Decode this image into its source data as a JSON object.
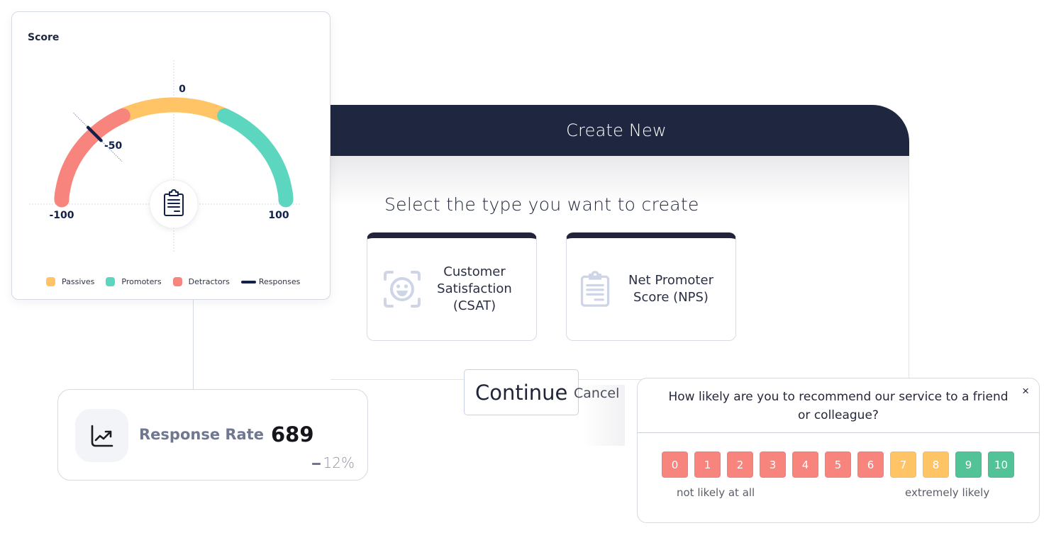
{
  "dialog": {
    "title": "Create New",
    "subtitle": "Select the type you want to create",
    "options": [
      {
        "label": "Customer Satisfaction (CSAT)",
        "icon": "smile-face-scan-icon"
      },
      {
        "label": "Net Promoter Score (NPS)",
        "icon": "clipboard-icon"
      }
    ],
    "continue_label": "Continue",
    "cancel_label": "Cancel"
  },
  "score_card": {
    "title": "Score",
    "gauge": {
      "min": -100,
      "max": 100,
      "labels": [
        "-100",
        "-50",
        "0",
        "100"
      ],
      "segments": [
        {
          "name": "Detractors",
          "from": -100,
          "to": -30,
          "color": "#f8847e"
        },
        {
          "name": "Passives",
          "from": -30,
          "to": 30,
          "color": "#fec466"
        },
        {
          "name": "Promoters",
          "from": 30,
          "to": 100,
          "color": "#5dd6c0"
        }
      ],
      "marker_value": -50,
      "marker_color": "#12204a",
      "center_icon": "clipboard-icon"
    },
    "legend": [
      {
        "label": "Passives",
        "color": "#fec466",
        "type": "swatch"
      },
      {
        "label": "Promoters",
        "color": "#5dd6c0",
        "type": "swatch"
      },
      {
        "label": "Detractors",
        "color": "#f8847e",
        "type": "swatch"
      },
      {
        "label": "Responses",
        "color": "#12204a",
        "type": "line"
      }
    ]
  },
  "response_rate": {
    "label": "Response Rate",
    "value": "689",
    "delta": "12%",
    "icon": "trending-up-chart-icon"
  },
  "survey": {
    "question": "How likely are you to recommend our service to a friend or colleague?",
    "close_label": "×",
    "scores": [
      {
        "label": "0",
        "color": "#f8847e"
      },
      {
        "label": "1",
        "color": "#f8847e"
      },
      {
        "label": "2",
        "color": "#f8847e"
      },
      {
        "label": "3",
        "color": "#f8847e"
      },
      {
        "label": "4",
        "color": "#f8847e"
      },
      {
        "label": "5",
        "color": "#f8847e"
      },
      {
        "label": "6",
        "color": "#f8847e"
      },
      {
        "label": "7",
        "color": "#fec466"
      },
      {
        "label": "8",
        "color": "#fec466"
      },
      {
        "label": "9",
        "color": "#52c297"
      },
      {
        "label": "10",
        "color": "#52c297"
      }
    ],
    "low_label": "not likely at all",
    "high_label": "extremely likely"
  }
}
